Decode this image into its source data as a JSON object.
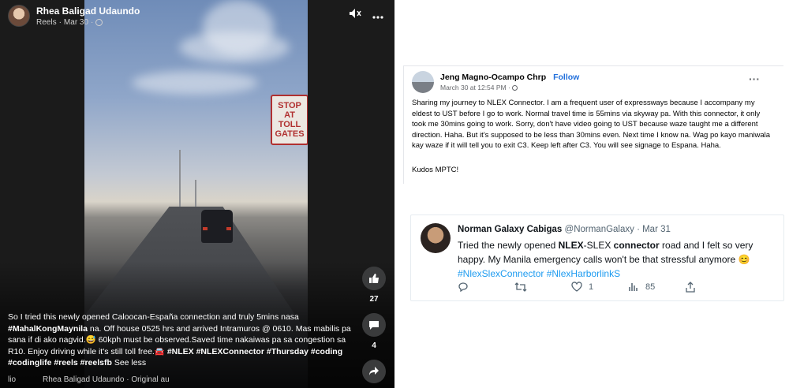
{
  "reel": {
    "author": "Rhea Baligad Udaundo",
    "meta_type": "Reels",
    "meta_date": "Mar 30",
    "sign_text": [
      "STOP",
      "AT",
      "TOLL",
      "GATES"
    ],
    "likes": "27",
    "comments": "4",
    "caption_parts": [
      {
        "t": "So I tried this newly opened Caloocan-España connection and truly 5mins nasa ",
        "b": false
      },
      {
        "t": "#MahalKongMaynila",
        "b": true
      },
      {
        "t": " na. Off house 0525 hrs and arrived Intramuros @ 0610. Mas mabilis pa sana if di ako nagvid.😅 60kph must be observed.Saved time nakaiwas pa sa congestion sa R10. Enjoy driving while it's still toll free.🚘 ",
        "b": false
      },
      {
        "t": "#NLEX #NLEXConnector #Thursday #coding #codinglife #reels #reelsfb",
        "b": true
      },
      {
        "t": " See less",
        "b": false
      }
    ],
    "footer_left": "lio",
    "footer_audio": "Rhea Baligad Udaundo · Original au"
  },
  "fb_post": {
    "author": "Jeng Magno-Ocampo Chrp",
    "follow": "Follow",
    "time": "March 30 at 12:54 PM · ",
    "body": "Sharing my journey to NLEX Connector. I am a frequent user of expressways because I accompany my eldest to UST before I go to work. Normal travel time is 55mins via skyway pa. With this connector, it only took me 30mins going to work. Sorry, don't have video going to UST because waze taught me a different direction. Haha. But it's supposed to be less than 30mins even. Next time I know na. Wag po kayo maniwala kay waze if it will tell you to exit C3. Keep left after C3. You will see signage to Espana. Haha.",
    "kudos": "Kudos MPTC!"
  },
  "tweet": {
    "name": "Norman Galaxy Cabigas",
    "handle": "@NormanGalaxy · Mar 31",
    "body_1": "Tried the newly opened ",
    "bold_1": "NLEX",
    "body_2": "-SLEX ",
    "bold_2": "connector",
    "body_3": " road and I felt so very happy. My Manila emergency calls won't be that stressful anymore 😊",
    "tags": "#NlexSlexConnector #NlexHarborlinkS",
    "likes": "1",
    "views": "85"
  },
  "icons": [
    "mute-icon",
    "more-icon",
    "like-icon",
    "comment-icon",
    "share-icon",
    "globe-icon",
    "reply-icon",
    "retweet-icon",
    "heart-icon",
    "views-icon",
    "upload-icon"
  ]
}
